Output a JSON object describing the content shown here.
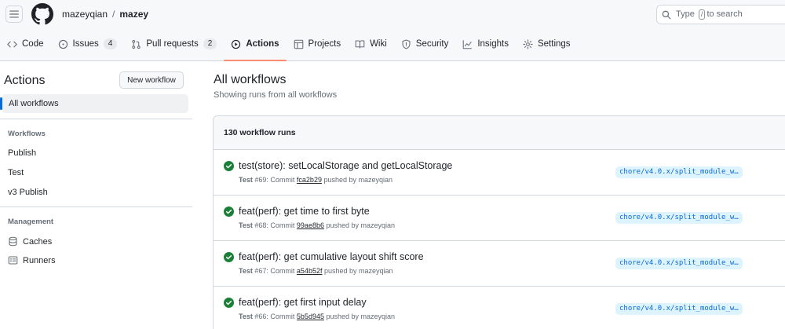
{
  "header": {
    "owner": "mazeyqian",
    "separator": "/",
    "repo": "mazey",
    "search": {
      "prefix": "Type",
      "key": "/",
      "suffix": "to search"
    }
  },
  "tabs": [
    {
      "label": "Code",
      "icon": "code-icon",
      "count": null
    },
    {
      "label": "Issues",
      "icon": "issue-icon",
      "count": "4"
    },
    {
      "label": "Pull requests",
      "icon": "pull-request-icon",
      "count": "2"
    },
    {
      "label": "Actions",
      "icon": "play-icon",
      "count": null,
      "selected": true
    },
    {
      "label": "Projects",
      "icon": "table-icon",
      "count": null
    },
    {
      "label": "Wiki",
      "icon": "book-icon",
      "count": null
    },
    {
      "label": "Security",
      "icon": "shield-icon",
      "count": null
    },
    {
      "label": "Insights",
      "icon": "graph-icon",
      "count": null
    },
    {
      "label": "Settings",
      "icon": "gear-icon",
      "count": null
    }
  ],
  "sidebar": {
    "title": "Actions",
    "new_workflow": "New workflow",
    "all_workflows": "All workflows",
    "workflows_heading": "Workflows",
    "workflows": [
      "Publish",
      "Test",
      "v3 Publish"
    ],
    "management_heading": "Management",
    "management": [
      {
        "label": "Caches",
        "icon": "cache-icon"
      },
      {
        "label": "Runners",
        "icon": "runners-icon"
      }
    ]
  },
  "main": {
    "title": "All workflows",
    "subtitle": "Showing runs from all workflows",
    "runs_count": "130 workflow runs",
    "runs": [
      {
        "title": "test(store): setLocalStorage and getLocalStorage",
        "workflow": "Test",
        "number": "#69",
        "commit_label": "Commit",
        "sha": "fca2b29",
        "pushed_by": "pushed by mazeyqian",
        "branch": "chore/v4.0.x/split_module_w…",
        "status": "success"
      },
      {
        "title": "feat(perf): get time to first byte",
        "workflow": "Test",
        "number": "#68",
        "commit_label": "Commit",
        "sha": "99ae8b6",
        "pushed_by": "pushed by mazeyqian",
        "branch": "chore/v4.0.x/split_module_w…",
        "status": "success"
      },
      {
        "title": "feat(perf): get cumulative layout shift score",
        "workflow": "Test",
        "number": "#67",
        "commit_label": "Commit",
        "sha": "a54b52f",
        "pushed_by": "pushed by mazeyqian",
        "branch": "chore/v4.0.x/split_module_w…",
        "status": "success"
      },
      {
        "title": "feat(perf): get first input delay",
        "workflow": "Test",
        "number": "#66",
        "commit_label": "Commit",
        "sha": "5b5d945",
        "pushed_by": "pushed by mazeyqian",
        "branch": "chore/v4.0.x/split_module_w…",
        "status": "success"
      }
    ]
  },
  "colors": {
    "accent": "#0969da",
    "success": "#1a7f37",
    "selected_tab_underline": "#fd8c73"
  }
}
